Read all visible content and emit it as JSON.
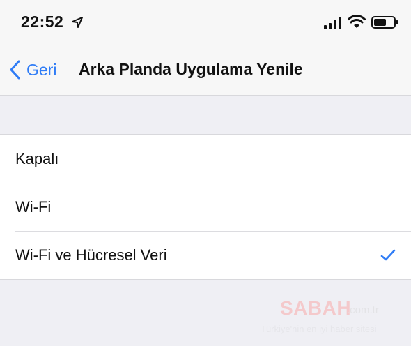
{
  "status_bar": {
    "time": "22:52",
    "icons": [
      "location-arrow-icon",
      "cellular-signal-icon",
      "wifi-icon",
      "battery-icon"
    ]
  },
  "nav": {
    "back_label": "Geri",
    "title": "Arka Planda Uygulama Yenile"
  },
  "options": [
    {
      "label": "Kapalı",
      "selected": false
    },
    {
      "label": "Wi-Fi",
      "selected": false
    },
    {
      "label": "Wi-Fi ve Hücresel Veri",
      "selected": true
    }
  ],
  "watermark": {
    "brand": "SABAH",
    "domain": ".com.tr",
    "tagline": "Türkiye'nin en iyi haber sitesi"
  },
  "colors": {
    "accent": "#2f7cf6",
    "background": "#efeff4",
    "cell": "#ffffff"
  }
}
